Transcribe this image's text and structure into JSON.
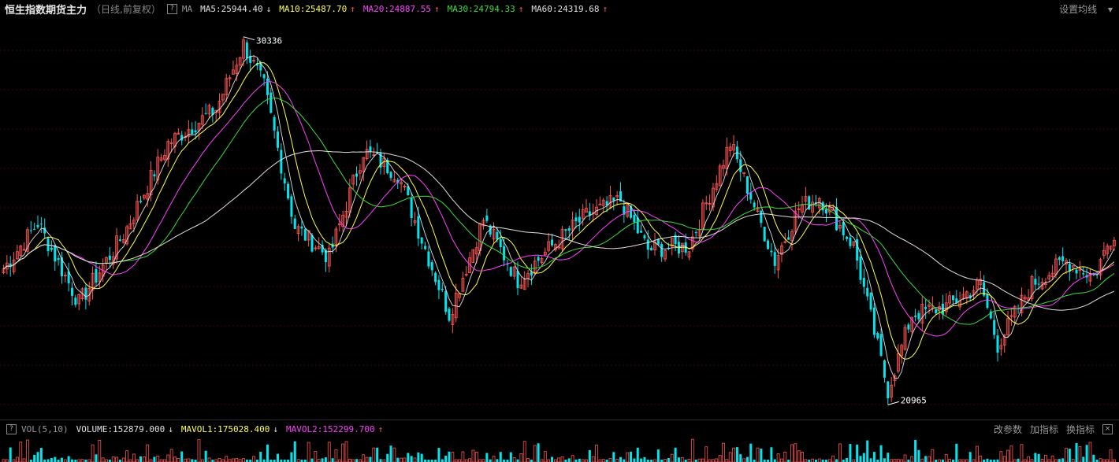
{
  "header": {
    "title": "恒生指数期货主力",
    "subtitle": "（日线,前复权）",
    "help_glyph": "?",
    "indicator_label": "MA",
    "ma_items": [
      {
        "text": "MA5:25944.40",
        "color": "#e0e0e0",
        "arrow": "↓"
      },
      {
        "text": "MA10:25487.70",
        "color": "#ffff4d",
        "arrow": "↑"
      },
      {
        "text": "MA20:24887.55",
        "color": "#ff40ff",
        "arrow": "↑"
      },
      {
        "text": "MA30:24794.33",
        "color": "#3ddc3d",
        "arrow": "↑"
      },
      {
        "text": "MA60:24319.68",
        "color": "#e0e0e0",
        "arrow": "↑"
      }
    ],
    "settings_label": "设置均线",
    "settings_caret": "▾"
  },
  "volume_header": {
    "help_glyph": "?",
    "indicator_label": "VOL(5,10)",
    "items": [
      {
        "text": "VOLUME:152879.000",
        "color": "#e0e0e0",
        "arrow": "↓"
      },
      {
        "text": "MAVOL1:175028.400",
        "color": "#ffff4d",
        "arrow": "↓"
      },
      {
        "text": "MAVOL2:152299.700",
        "color": "#ff40ff",
        "arrow": "↑"
      }
    ],
    "actions": [
      "改参数",
      "加指标",
      "换指标"
    ],
    "close_glyph": "×"
  },
  "colors": {
    "up": "#ff5555",
    "down": "#00e5ee",
    "ma5": "#e0e0e0",
    "ma10": "#ffff4d",
    "ma20": "#ff40ff",
    "ma30": "#3ddc3d",
    "ma60": "#e0e0e0",
    "grid": "#4a0000"
  },
  "chart_data": {
    "type": "candlestick",
    "high_annotation": "30336",
    "low_annotation": "20965",
    "grid": true,
    "anchors": [
      [
        0,
        24200
      ],
      [
        10,
        25400
      ],
      [
        22,
        23300
      ],
      [
        35,
        25100
      ],
      [
        48,
        27500
      ],
      [
        62,
        28400
      ],
      [
        70,
        30100
      ],
      [
        76,
        29000
      ],
      [
        85,
        25300
      ],
      [
        95,
        24500
      ],
      [
        105,
        27300
      ],
      [
        115,
        26700
      ],
      [
        130,
        23000
      ],
      [
        140,
        25500
      ],
      [
        150,
        23900
      ],
      [
        160,
        24800
      ],
      [
        170,
        25600
      ],
      [
        180,
        26000
      ],
      [
        188,
        24700
      ],
      [
        200,
        24800
      ],
      [
        212,
        27500
      ],
      [
        218,
        26100
      ],
      [
        225,
        24400
      ],
      [
        232,
        25800
      ],
      [
        238,
        26100
      ],
      [
        248,
        24800
      ],
      [
        258,
        21000
      ],
      [
        265,
        23000
      ],
      [
        275,
        23200
      ],
      [
        285,
        23800
      ],
      [
        290,
        22200
      ],
      [
        300,
        23800
      ],
      [
        310,
        24400
      ],
      [
        318,
        24000
      ],
      [
        324,
        25200
      ]
    ]
  }
}
